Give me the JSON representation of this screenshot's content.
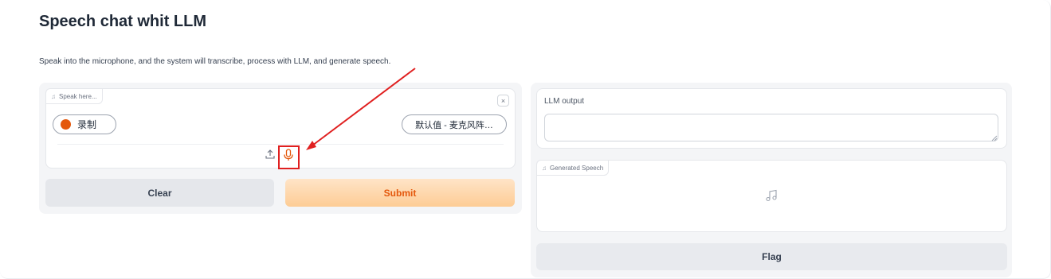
{
  "header": {
    "title": "Speech chat whit LLM",
    "description": "Speak into the microphone, and the system will transcribe, process with LLM, and generate speech."
  },
  "input_audio": {
    "label": "Speak here...",
    "close_symbol": "×",
    "record_label": "录制",
    "device_value": "默认值 - 麦克风阵…",
    "icons": [
      "music-note-icon",
      "close-icon",
      "upload-icon",
      "microphone-icon"
    ]
  },
  "buttons": {
    "clear": "Clear",
    "submit": "Submit",
    "flag": "Flag"
  },
  "llm_output": {
    "label": "LLM output",
    "value": ""
  },
  "generated_speech": {
    "label": "Generated Speech",
    "icons": [
      "music-note-icon"
    ]
  },
  "colors": {
    "accent": "#e4580c",
    "submit_bg_top": "#ffe4c7",
    "submit_bg_bottom": "#fdcc95",
    "annotation": "#e02020"
  }
}
